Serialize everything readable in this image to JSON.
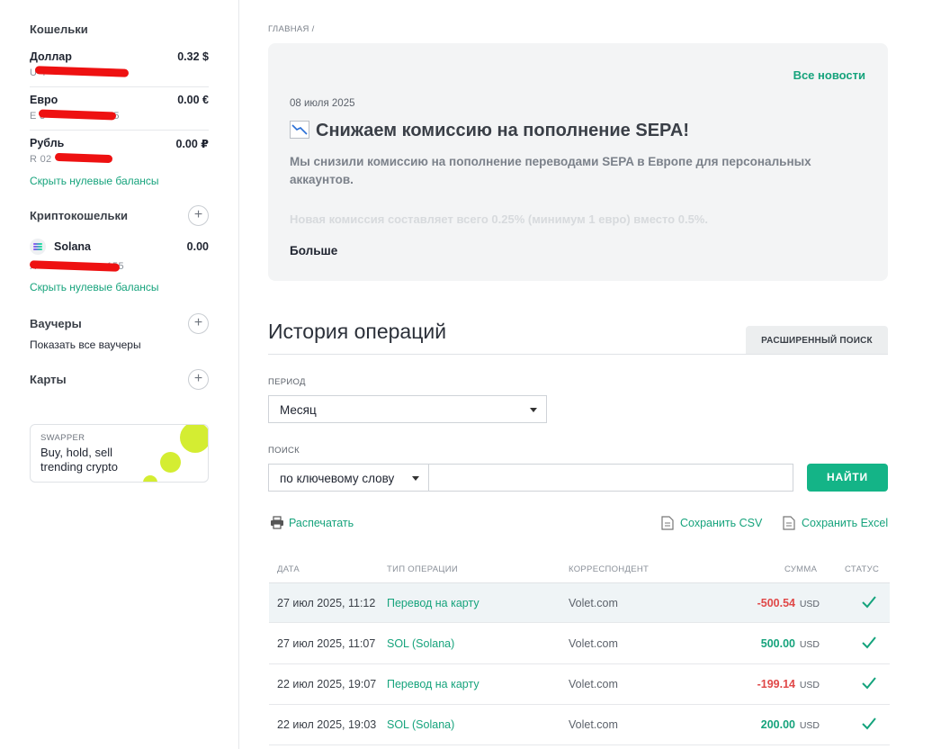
{
  "sidebar": {
    "wallets_title": "Кошельки",
    "wallets": [
      {
        "name": "Доллар",
        "balance": "0.32 $",
        "account": "U 4",
        "account_tail": "5"
      },
      {
        "name": "Евро",
        "balance": "0.00 €",
        "account": "E 8",
        "account_tail": "5"
      },
      {
        "name": "Рубль",
        "balance": "0.00 ₽",
        "account": "R 02",
        "account_tail": "5"
      }
    ],
    "hide_zero_1": "Скрыть нулевые балансы",
    "crypto_title": "Криптокошельки",
    "crypto": {
      "name": "Solana",
      "balance": "0.00",
      "account": "X",
      "account_tail": "155"
    },
    "hide_zero_2": "Скрыть нулевые балансы",
    "vouchers_title": "Ваучеры",
    "show_vouchers": "Показать все ваучеры",
    "cards_title": "Карты",
    "promo": {
      "tag": "SWAPPER",
      "text": "Buy, hold, sell trending crypto"
    }
  },
  "breadcrumb": "ГЛАВНАЯ /",
  "news": {
    "all_link": "Все новости",
    "date": "08 июля 2025",
    "title": "Снижаем комиссию на пополнение SEPA!",
    "body": "Мы снизили комиссию на пополнение переводами SEPA в Европе для персональных аккаунтов.",
    "faded": "Новая комиссия составляет всего 0.25% (минимум 1 евро) вместо 0.5%.",
    "more": "Больше"
  },
  "history": {
    "title": "История операций",
    "advanced_search": "РАСШИРЕННЫЙ ПОИСК",
    "period_label": "ПЕРИОД",
    "period_value": "Месяц",
    "search_label": "ПОИСК",
    "search_mode": "по ключевому слову",
    "search_value": "",
    "find_button": "НАЙТИ",
    "print": "Распечатать",
    "save_csv": "Сохранить CSV",
    "save_excel": "Сохранить Excel",
    "columns": [
      "ДАТА",
      "ТИП ОПЕРАЦИИ",
      "КОРРЕСПОНДЕНТ",
      "СУММА",
      "СТАТУС"
    ],
    "rows": [
      {
        "date": "27 июл 2025, 11:12",
        "type": "Перевод на карту",
        "corr": "Volet.com",
        "amount": "-500.54",
        "currency": "USD"
      },
      {
        "date": "27 июл 2025, 11:07",
        "type": "SOL (Solana)",
        "corr": "Volet.com",
        "amount": "500.00",
        "currency": "USD"
      },
      {
        "date": "22 июл 2025, 19:07",
        "type": "Перевод на карту",
        "corr": "Volet.com",
        "amount": "-199.14",
        "currency": "USD"
      },
      {
        "date": "22 июл 2025, 19:03",
        "type": "SOL (Solana)",
        "corr": "Volet.com",
        "amount": "200.00",
        "currency": "USD"
      }
    ]
  },
  "colors": {
    "accent": "#14b487",
    "negative": "#e04848",
    "redaction": "#ee1111"
  }
}
